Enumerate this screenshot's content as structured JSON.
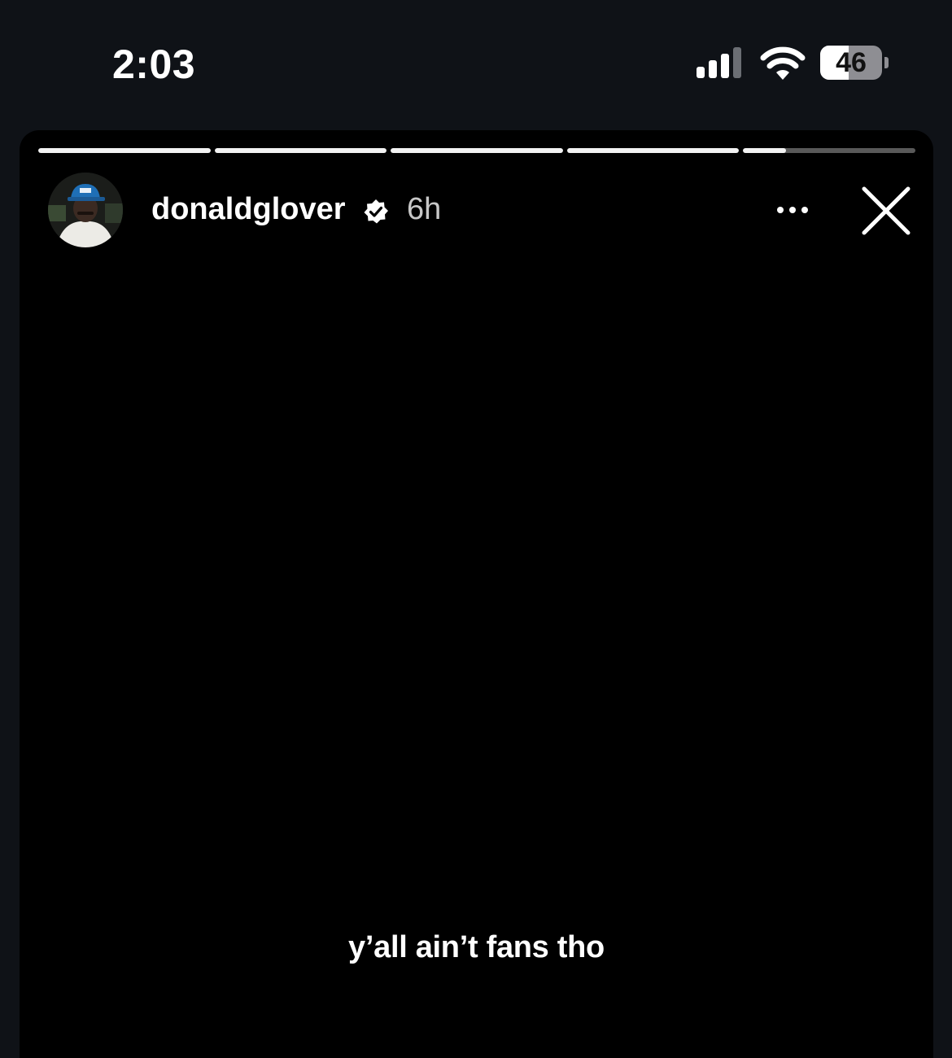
{
  "status_bar": {
    "time": "2:03",
    "signal_icon": "cellular-signal-icon",
    "wifi_icon": "wifi-icon",
    "battery_level": "46",
    "battery_fraction": 0.46
  },
  "story": {
    "segments": [
      {
        "progress": 1.0
      },
      {
        "progress": 1.0
      },
      {
        "progress": 1.0
      },
      {
        "progress": 1.0
      },
      {
        "progress": 0.25
      }
    ],
    "username": "donaldglover",
    "verified_icon": "verified-badge-icon",
    "timestamp": "6h",
    "more_icon": "more-options-icon",
    "close_icon": "close-icon",
    "caption": "y’all ain’t fans tho"
  },
  "colors": {
    "status_bg": "#0f1217",
    "story_bg": "#000000",
    "avatar_hat": "#1f6fb6"
  }
}
